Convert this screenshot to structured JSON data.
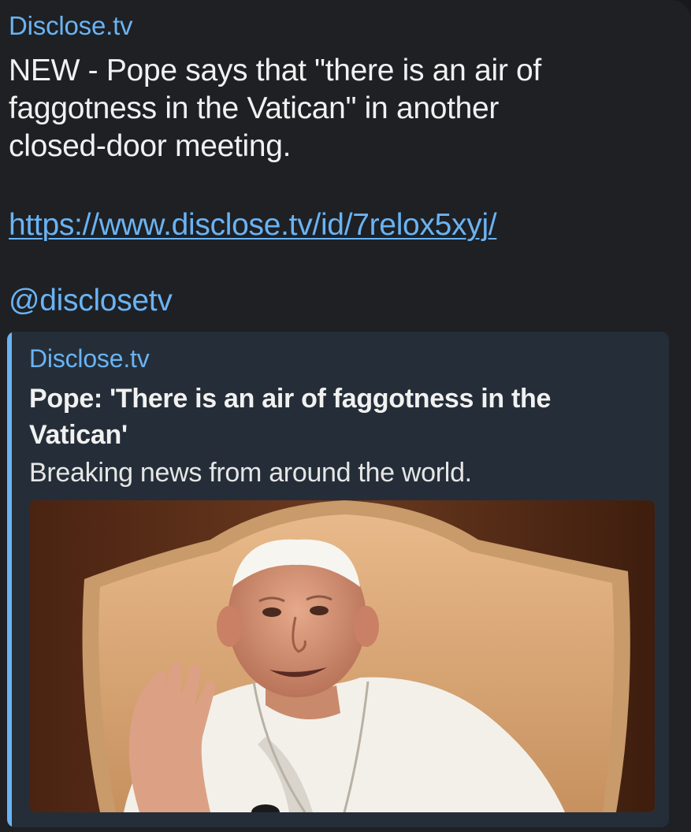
{
  "message": {
    "sender": "Disclose.tv",
    "text": "NEW - Pope says that \"there is an air of\nfaggotness in the Vatican\" in another\nclosed-door meeting.",
    "link": "https://www.disclose.tv/id/7relox5xyj/",
    "mention": "@disclosetv"
  },
  "preview": {
    "site_name": "Disclose.tv",
    "title": "Pope: 'There is an air of faggotness in the Vatican'",
    "description": "Breaking news from around the world.",
    "image_icon": "photo-pope-waving"
  },
  "colors": {
    "background": "#17191c",
    "bubble": "#1e2024",
    "accent": "#6ab3f3",
    "preview_background": "#252e38",
    "text": "#f1f1f1"
  }
}
